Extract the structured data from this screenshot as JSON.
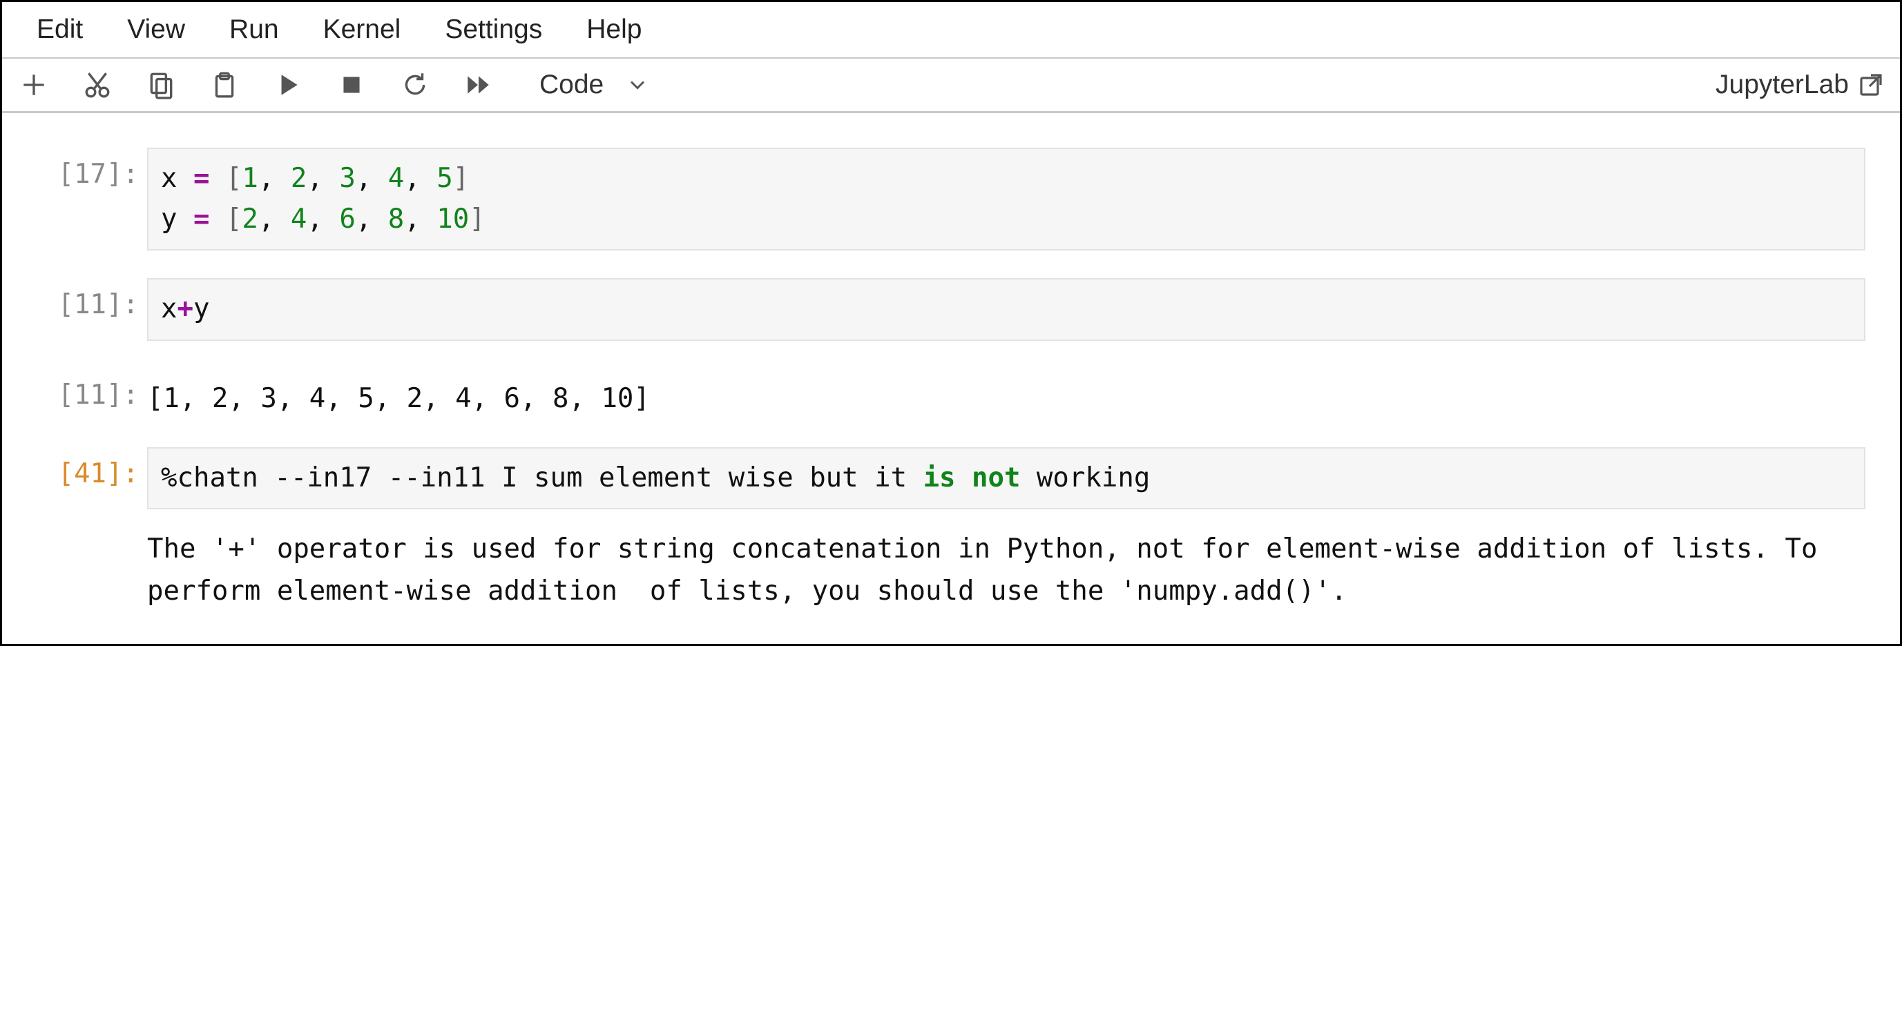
{
  "menubar": {
    "items": [
      "Edit",
      "View",
      "Run",
      "Kernel",
      "Settings",
      "Help"
    ]
  },
  "toolbar": {
    "celltype_label": "Code",
    "brand_label": "JupyterLab"
  },
  "cells": [
    {
      "prompt": "[17]:",
      "code_tokens": [
        [
          {
            "t": "x ",
            "c": "var"
          },
          {
            "t": "=",
            "c": "op"
          },
          {
            "t": " ",
            "c": "var"
          },
          {
            "t": "[",
            "c": "br"
          },
          {
            "t": "1",
            "c": "num"
          },
          {
            "t": ", ",
            "c": "pun"
          },
          {
            "t": "2",
            "c": "num"
          },
          {
            "t": ", ",
            "c": "pun"
          },
          {
            "t": "3",
            "c": "num"
          },
          {
            "t": ", ",
            "c": "pun"
          },
          {
            "t": "4",
            "c": "num"
          },
          {
            "t": ", ",
            "c": "pun"
          },
          {
            "t": "5",
            "c": "num"
          },
          {
            "t": "]",
            "c": "br"
          }
        ],
        [
          {
            "t": "y ",
            "c": "var"
          },
          {
            "t": "=",
            "c": "op"
          },
          {
            "t": " ",
            "c": "var"
          },
          {
            "t": "[",
            "c": "br"
          },
          {
            "t": "2",
            "c": "num"
          },
          {
            "t": ", ",
            "c": "pun"
          },
          {
            "t": "4",
            "c": "num"
          },
          {
            "t": ", ",
            "c": "pun"
          },
          {
            "t": "6",
            "c": "num"
          },
          {
            "t": ", ",
            "c": "pun"
          },
          {
            "t": "8",
            "c": "num"
          },
          {
            "t": ", ",
            "c": "pun"
          },
          {
            "t": "10",
            "c": "num"
          },
          {
            "t": "]",
            "c": "br"
          }
        ]
      ]
    },
    {
      "prompt": "[11]:",
      "code_tokens": [
        [
          {
            "t": "x",
            "c": "var"
          },
          {
            "t": "+",
            "c": "op"
          },
          {
            "t": "y",
            "c": "var"
          }
        ]
      ]
    },
    {
      "prompt": "[11]:",
      "output_text": "[1, 2, 3, 4, 5, 2, 4, 6, 8, 10]"
    },
    {
      "prompt": "[41]:",
      "active": true,
      "code_tokens": [
        [
          {
            "t": "%chatn --in17 --in11 I sum element wise but it ",
            "c": "cmd"
          },
          {
            "t": "is not",
            "c": "kw"
          },
          {
            "t": " working",
            "c": "cmd"
          }
        ]
      ],
      "trailing_text": "The '+' operator is used for string concatenation in Python, not for element-wise addition of lists. To perform element-wise addition  of lists, you should use the 'numpy.add()'."
    }
  ]
}
